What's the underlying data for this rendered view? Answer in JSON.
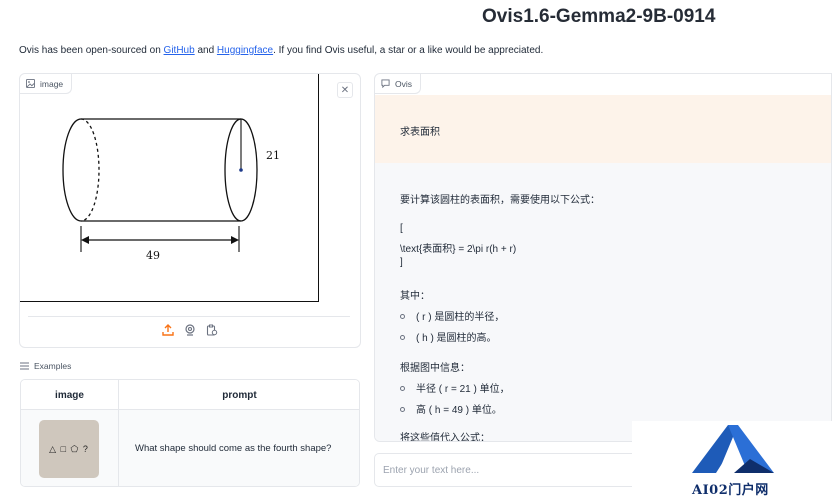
{
  "app": {
    "title": "Ovis1.6-Gemma2-9B-0914"
  },
  "intro": {
    "prefix": "Ovis has been open-sourced on ",
    "github_link": "GitHub",
    "and": " and ",
    "hf_link": "Huggingface",
    "suffix": ". If you find Ovis useful, a star or a like would be appreciated."
  },
  "image_panel": {
    "label": "image",
    "close_icon": "close-icon",
    "figure_labels": {
      "radius": "21",
      "length": "49"
    },
    "toolbar_icons": [
      "upload-icon",
      "webcam-icon",
      "clipboard-icon"
    ]
  },
  "examples": {
    "label": "Examples",
    "columns": [
      "image",
      "prompt"
    ],
    "rows": [
      {
        "thumbnail_text": "△ □ ⬠ ?",
        "prompt": "What shape should come as the fourth shape?"
      }
    ]
  },
  "chatbot": {
    "label": "Ovis",
    "user_message": "求表面积",
    "bot_lines": [
      "要计算该圆柱的表面积，需要使用以下公式：",
      "[",
      "\\text{表面积} = 2\\pi r(h + r)",
      "]",
      "其中：",
      "根据图中信息：",
      "将这些值代入公式："
    ],
    "bot_list_1": [
      "( r ) 是圆柱的半径，",
      "( h ) 是圆柱的高。"
    ],
    "bot_list_2": [
      "半径 ( r = 21 ) 单位，",
      "高 ( h = 49 ) 单位。"
    ]
  },
  "input": {
    "placeholder": "Enter your text here..."
  },
  "watermark": {
    "text": "AI02门户网",
    "logo_icon": "a-logo-icon"
  },
  "colors": {
    "accent": "#f97316",
    "link": "#2563eb",
    "user_bubble": "#fdf3ea",
    "bot_bubble": "#f7f8fa",
    "watermark_blue": "#1e5bb8"
  }
}
